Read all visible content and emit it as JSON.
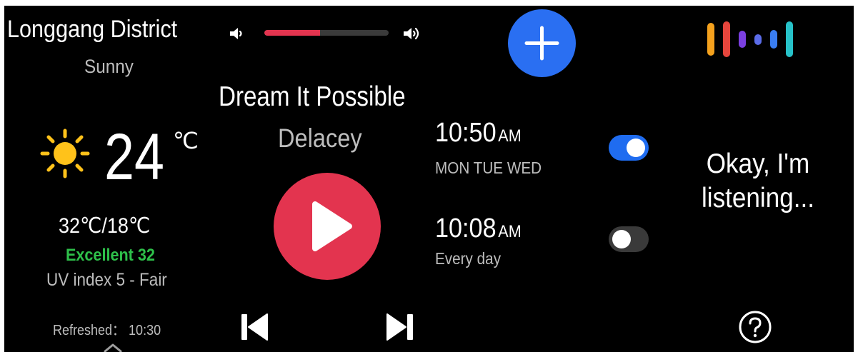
{
  "weather": {
    "location": "Longgang District",
    "condition": "Sunny",
    "temperature": "24",
    "unit": "℃",
    "range": "32℃/18℃",
    "air_quality": "Excellent 32",
    "uv_index": "UV index 5 - Fair",
    "refreshed": "Refreshed： 10:30",
    "icon": "sun-icon"
  },
  "volume": {
    "level_percent": 45,
    "fill_color": "#e3344f"
  },
  "music": {
    "title": "Dream It Possible",
    "artist": "Delacey",
    "accent_color": "#e3344f"
  },
  "alarms": [
    {
      "time": "10:50",
      "ampm": "AM",
      "days": "MON TUE WED",
      "enabled": true
    },
    {
      "time": "10:08",
      "ampm": "AM",
      "days": "Every day",
      "enabled": false
    }
  ],
  "assistant": {
    "status": "Okay, I'm listening..."
  },
  "colors": {
    "background": "#000000",
    "add_button": "#2a6ff2",
    "toggle_on": "#1f6cf0",
    "toggle_off": "#3a3a3a",
    "air_quality": "#2ec04a"
  }
}
